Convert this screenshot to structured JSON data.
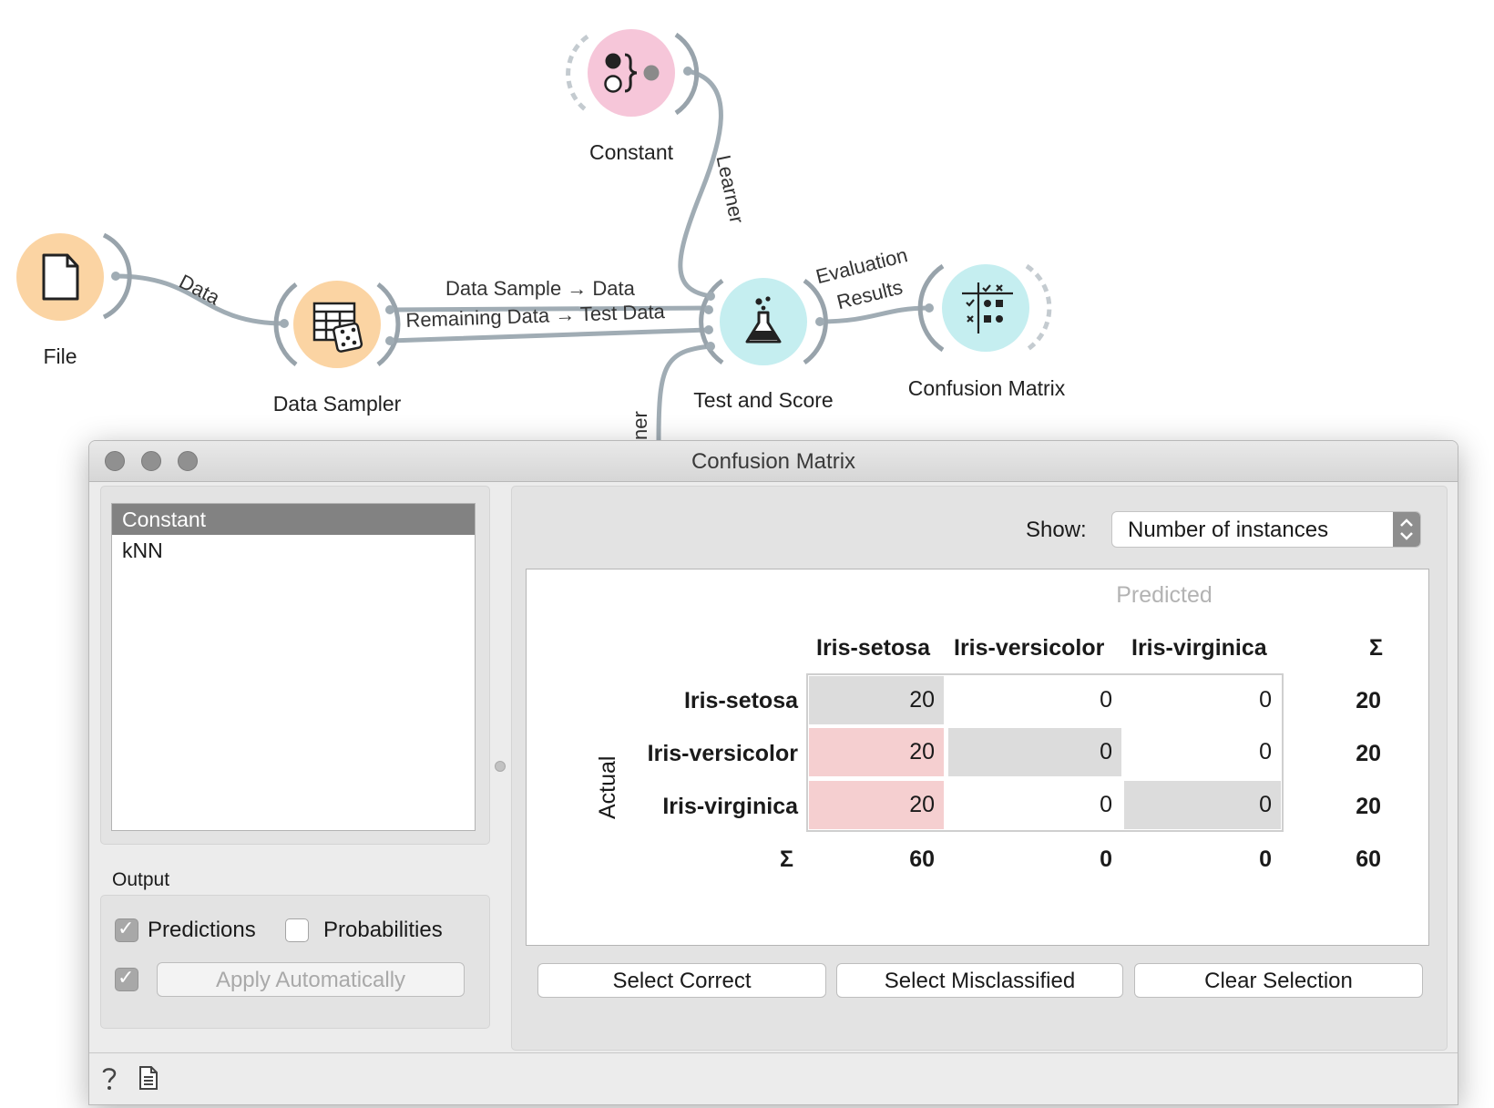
{
  "workflow": {
    "nodes": {
      "file": "File",
      "data_sampler": "Data Sampler",
      "constant": "Constant",
      "test_and_score": "Test and Score",
      "confusion_matrix": "Confusion Matrix"
    },
    "links": {
      "data": "Data",
      "sample_data": "Data Sample → Data",
      "remaining_test": "Remaining Data → Test Data",
      "learner": "Learner",
      "learner_partial": "ner",
      "evaluation_1": "Evaluation",
      "evaluation_2": "Results"
    },
    "colors": {
      "orange": "#fbd4a3",
      "pink": "#f6c6d9",
      "teal": "#c5eef0",
      "link": "#a0acb4"
    }
  },
  "window": {
    "title": "Confusion Matrix",
    "learners": [
      "Constant",
      "kNN"
    ],
    "selected_learner": "Constant",
    "output": {
      "title": "Output",
      "predictions_label": "Predictions",
      "predictions_checked": true,
      "probabilities_label": "Probabilities",
      "probabilities_checked": false,
      "apply_automatically_checked": true,
      "apply_label": "Apply Automatically"
    },
    "show": {
      "label": "Show:",
      "value": "Number of instances"
    },
    "matrix": {
      "predicted_label": "Predicted",
      "actual_label": "Actual",
      "classes": [
        "Iris-setosa",
        "Iris-versicolor",
        "Iris-virginica"
      ],
      "sigma": "Σ",
      "rows": [
        {
          "values": [
            "20",
            "0",
            "0"
          ],
          "total": "20"
        },
        {
          "values": [
            "20",
            "0",
            "0"
          ],
          "total": "20"
        },
        {
          "values": [
            "20",
            "0",
            "0"
          ],
          "total": "20"
        }
      ],
      "col_totals": [
        "60",
        "0",
        "0"
      ],
      "grand_total": "60",
      "colors": {
        "correct": "#dcdcdc",
        "misclassified": "#f5cfd0"
      }
    },
    "buttons": {
      "select_correct": "Select Correct",
      "select_misclassified": "Select Misclassified",
      "clear_selection": "Clear Selection"
    }
  }
}
